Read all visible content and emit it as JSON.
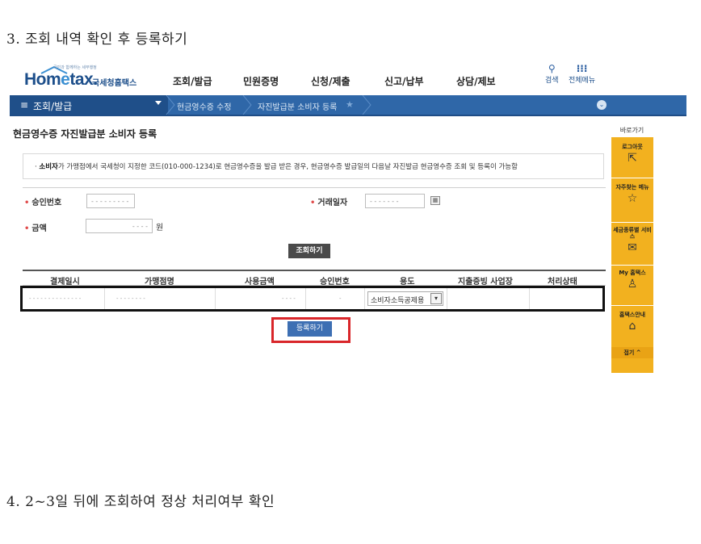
{
  "steps": {
    "step3": "3. 조회 내역 확인 후 등록하기",
    "step4": "4. 2~3일 뒤에 조회하여 정상 처리여부 확인"
  },
  "header": {
    "logo_slogan": "국민과 함께하는 세무행정",
    "logo_home": "Hom",
    "logo_e": "e",
    "logo_tax": "tax.",
    "logo_kr": "국세청홈택스",
    "menu": [
      "조회/발급",
      "민원증명",
      "신청/제출",
      "신고/납부",
      "상담/제보"
    ],
    "search_label": "검색",
    "all_menu_label": "전체메뉴",
    "search_icon": "search-icon",
    "grid_icon": "grid-icon"
  },
  "breadcrumb": {
    "main": "조회/발급",
    "crumbs": [
      "현금영수증 수정",
      "자진발급분 소비자 등록"
    ]
  },
  "page": {
    "title": "현금영수증 자진발급분 소비자 등록",
    "notice_bold": "소비자",
    "notice_text": "가 가맹점에서 국세청이 지정한 코드(010-000-1234)로 현금영수증을 발급 받은 경우, 현금영수증 발급일의 다음날 자진발급 현금영수증 조회 및 등록이 가능함"
  },
  "form": {
    "approval_label": "승인번호",
    "approval_value": "- - - - - - - - -",
    "date_label": "거래일자",
    "date_value": "- - - -  - - -",
    "amount_label": "금액",
    "amount_value": "- - - -",
    "won": "원",
    "search_button": "조회하기"
  },
  "table": {
    "headers": [
      "결제일시",
      "가맹점명",
      "사용금액",
      "승인번호",
      "용도",
      "지출증빙 사업장",
      "처리상태"
    ],
    "row": {
      "datetime": "- - - -  - -  - -  - - - - - -",
      "merchant": "- - -  - - - - -",
      "amount": "- - - -",
      "approval": "-",
      "usage": "소비자소득공제용"
    }
  },
  "register_button": "등록하기",
  "quick_panel": {
    "title": "바로가기",
    "logout": "로그아웃",
    "favorites": "자주찾는 메뉴",
    "tax_service": "세금종류별 서비스",
    "my_hometax": "My 홈택스",
    "hometax_guide": "홈택스안내",
    "close": "접기 ^"
  },
  "colors": {
    "brand_blue": "#2f67a8",
    "highlight_red": "#d9262a",
    "quick_panel": "#f2b11f"
  }
}
